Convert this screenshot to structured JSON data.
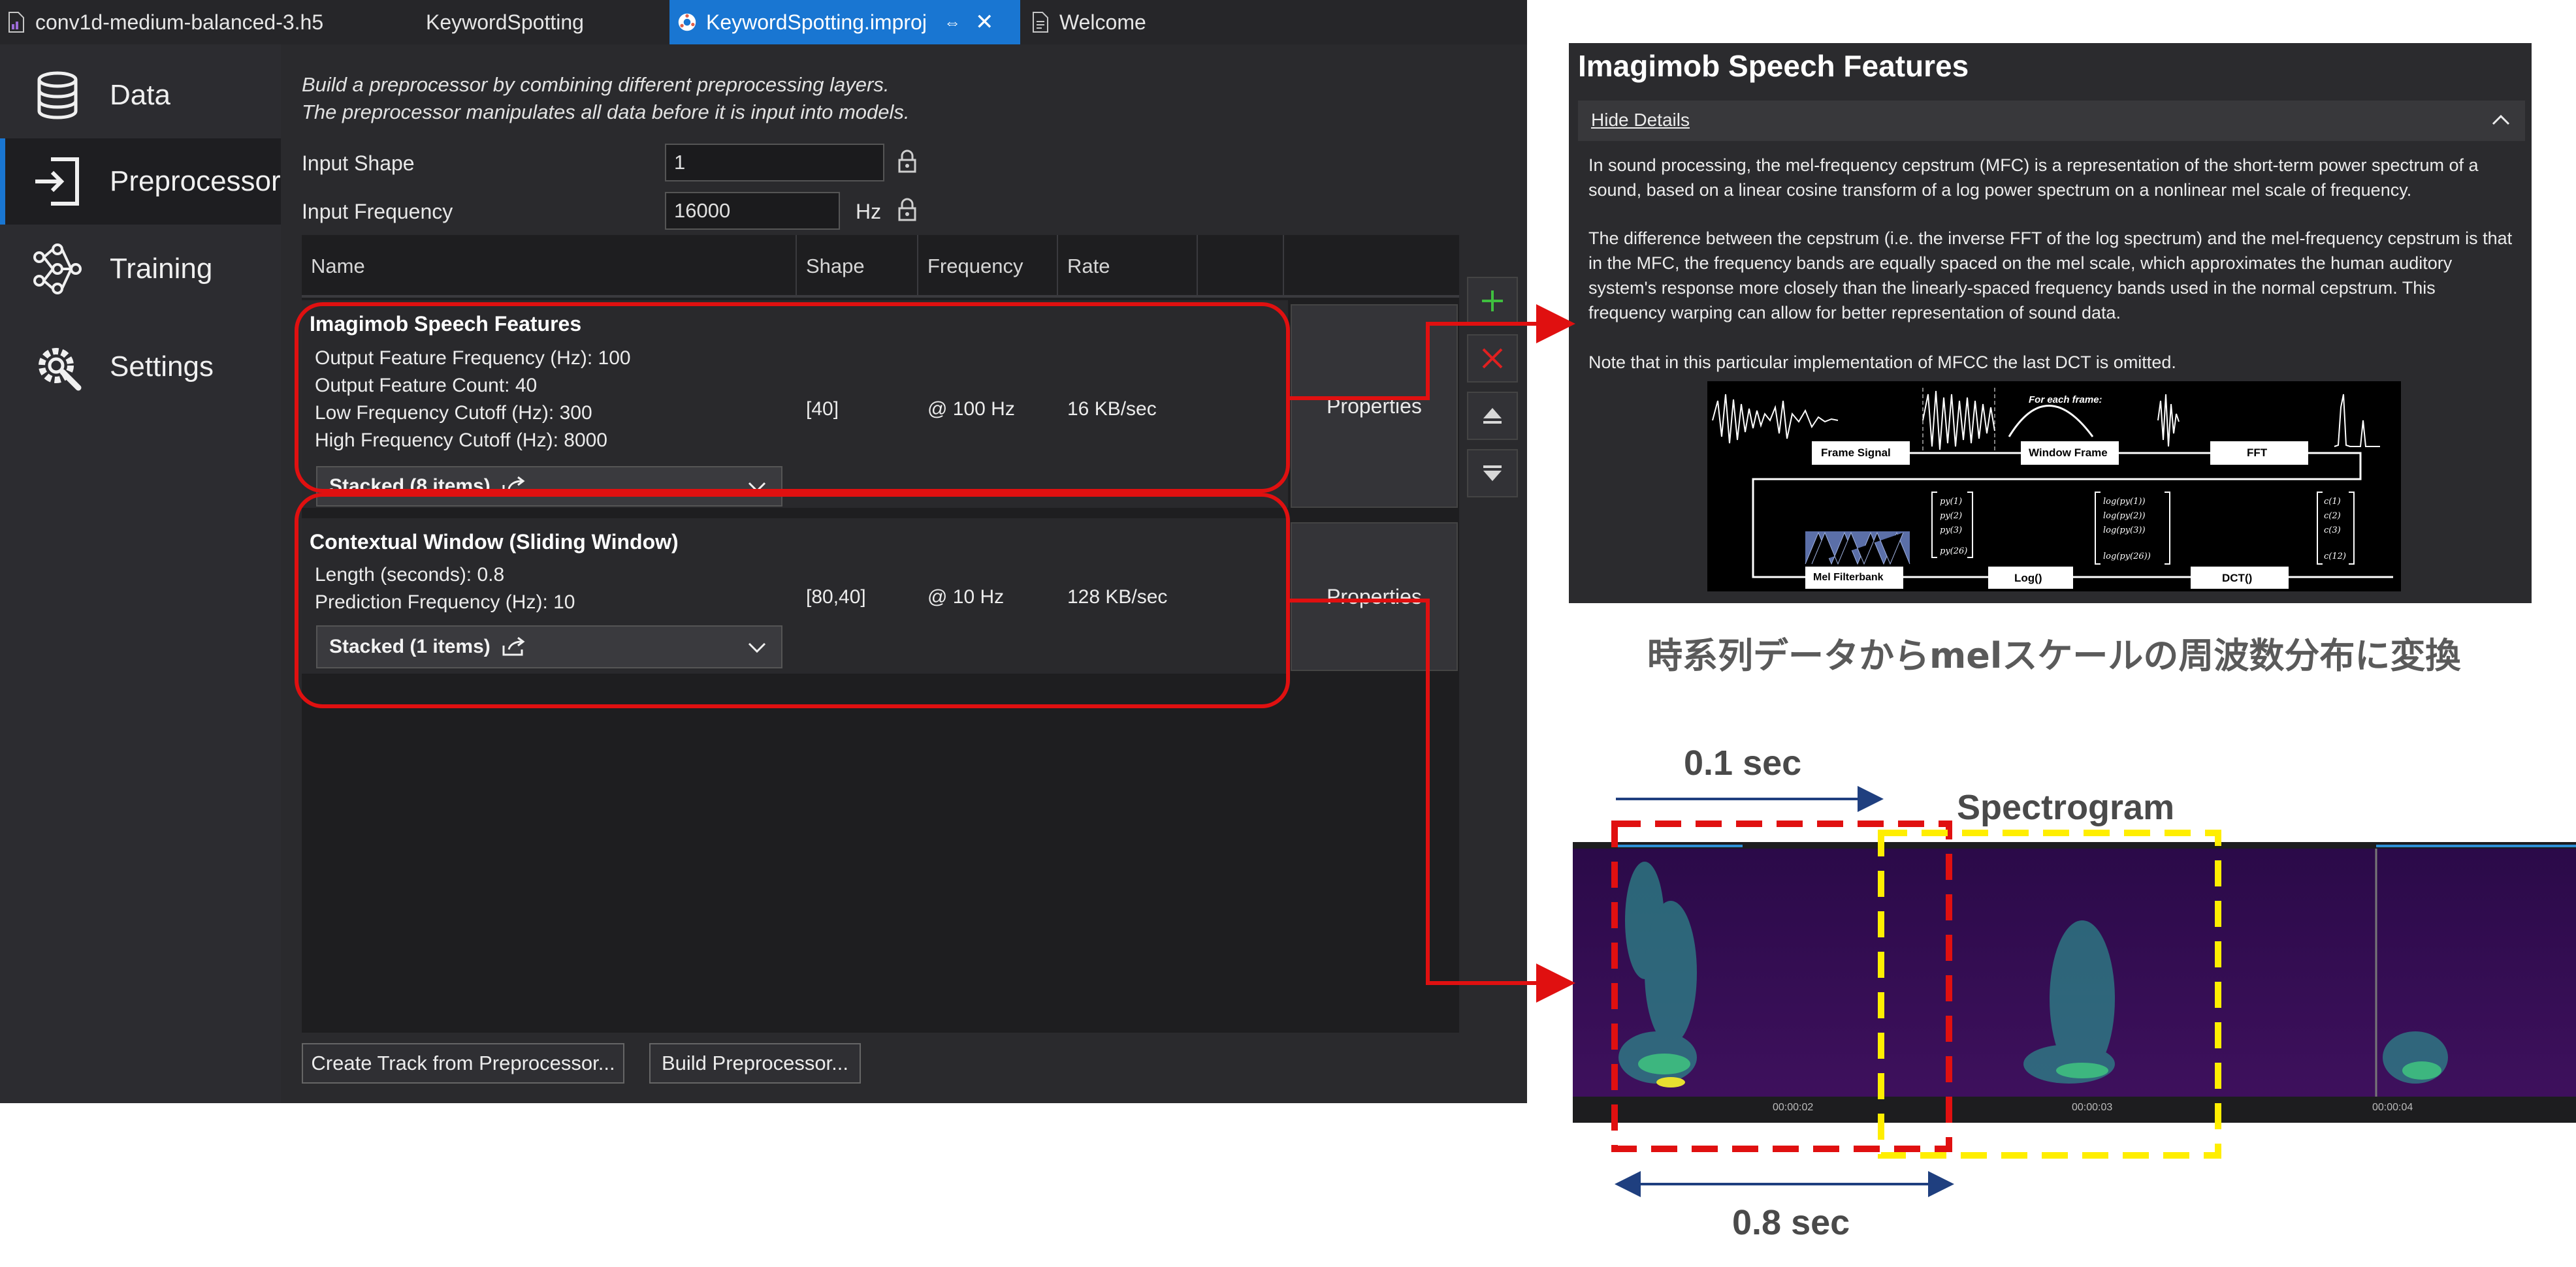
{
  "tabs": [
    {
      "label": "conv1d-medium-balanced-3.h5"
    },
    {
      "label": "KeywordSpotting"
    },
    {
      "label": "KeywordSpotting.improj",
      "pin": "⇔",
      "close": "✕"
    },
    {
      "label": "Welcome"
    }
  ],
  "sidebar": {
    "items": [
      {
        "label": "Data"
      },
      {
        "label": "Preprocessor"
      },
      {
        "label": "Training"
      },
      {
        "label": "Settings"
      }
    ]
  },
  "intro": {
    "line1": "Build a preprocessor by combining different preprocessing layers.",
    "line2": "The preprocessor manipulates all data before it is input into models."
  },
  "form": {
    "input_shape_label": "Input Shape",
    "input_shape_value": "1",
    "input_frequency_label": "Input Frequency",
    "input_frequency_value": "16000",
    "input_frequency_unit": "Hz"
  },
  "table": {
    "headers": [
      "Name",
      "Shape",
      "Frequency",
      "Rate"
    ],
    "rows": [
      {
        "title": "Imagimob Speech Features",
        "details": [
          "Output Feature Frequency (Hz): 100",
          "Output Feature Count: 40",
          "Low Frequency Cutoff (Hz): 300",
          "High Frequency Cutoff (Hz): 8000"
        ],
        "stacked": "Stacked (8 items)",
        "shape": "[40]",
        "frequency": "@ 100 Hz",
        "rate": "16 KB/sec",
        "properties": "Properties"
      },
      {
        "title": "Contextual Window (Sliding Window)",
        "details": [
          "Length (seconds): 0.8",
          "Prediction Frequency (Hz): 10"
        ],
        "stacked": "Stacked (1 items)",
        "shape": "[80,40]",
        "frequency": "@ 10 Hz",
        "rate": "128 KB/sec",
        "properties": "Properties"
      }
    ]
  },
  "buttons": {
    "create_track": "Create Track from Preprocessor...",
    "build": "Build Preprocessor..."
  },
  "feature_panel": {
    "title": "Imagimob Speech Features",
    "hide_details": "Hide Details",
    "paragraphs": [
      "In sound processing, the mel-frequency cepstrum (MFC) is a representation of the short-term power spectrum of a sound, based on a linear cosine transform of a log power spectrum on a nonlinear mel scale of frequency.",
      "The difference between the cepstrum (i.e. the inverse FFT of the log spectrum) and the mel-frequency cepstrum is that in the MFC, the frequency bands are equally spaced on the mel scale, which approximates the human auditory system's response more closely than the linearly-spaced frequency bands used in the normal cepstrum. This frequency warping can allow for better representation of sound data.",
      "Note that in this particular implementation of MFCC the last DCT is omitted."
    ],
    "diagram": {
      "for_each_frame": "For each frame:",
      "frame_signal": "Frame Signal",
      "window_frame": "Window Frame",
      "fft": "FFT",
      "mel_filterbank": "Mel Filterbank",
      "log": "Log()",
      "dct": "DCT()"
    }
  },
  "annotations": {
    "caption_jp": "時系列データからmelスケールの周波数分布に変換",
    "sec_01": "0.1 sec",
    "spectrogram": "Spectrogram",
    "sec_08": "0.8 sec",
    "timestamps": [
      "00:00:02",
      "00:00:03",
      "00:00:04"
    ]
  },
  "colors": {
    "accent": "#1976d2",
    "highlight_red": "#e01010",
    "highlight_yellow": "#ffee00",
    "arrow_blue": "#1f3f7f"
  }
}
